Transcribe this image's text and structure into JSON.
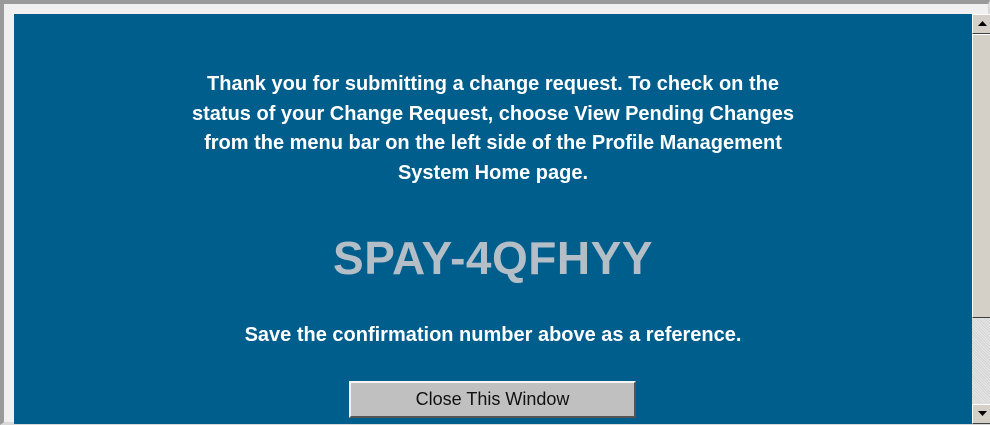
{
  "message": {
    "line1": "Thank you for submitting a change request. To check on the",
    "line2": "status of your Change Request, choose View Pending Changes",
    "line3": "from the menu bar on the left side of the Profile Management",
    "line4": "System Home page."
  },
  "confirmation_number": "SPAY-4QFHYY",
  "save_note": "Save the confirmation number above as a reference.",
  "close_button_label": "Close This Window",
  "colors": {
    "background": "#005e8d",
    "text": "#ffffff",
    "confirmation": "#b4bec6",
    "button": "#c0c0c0"
  }
}
